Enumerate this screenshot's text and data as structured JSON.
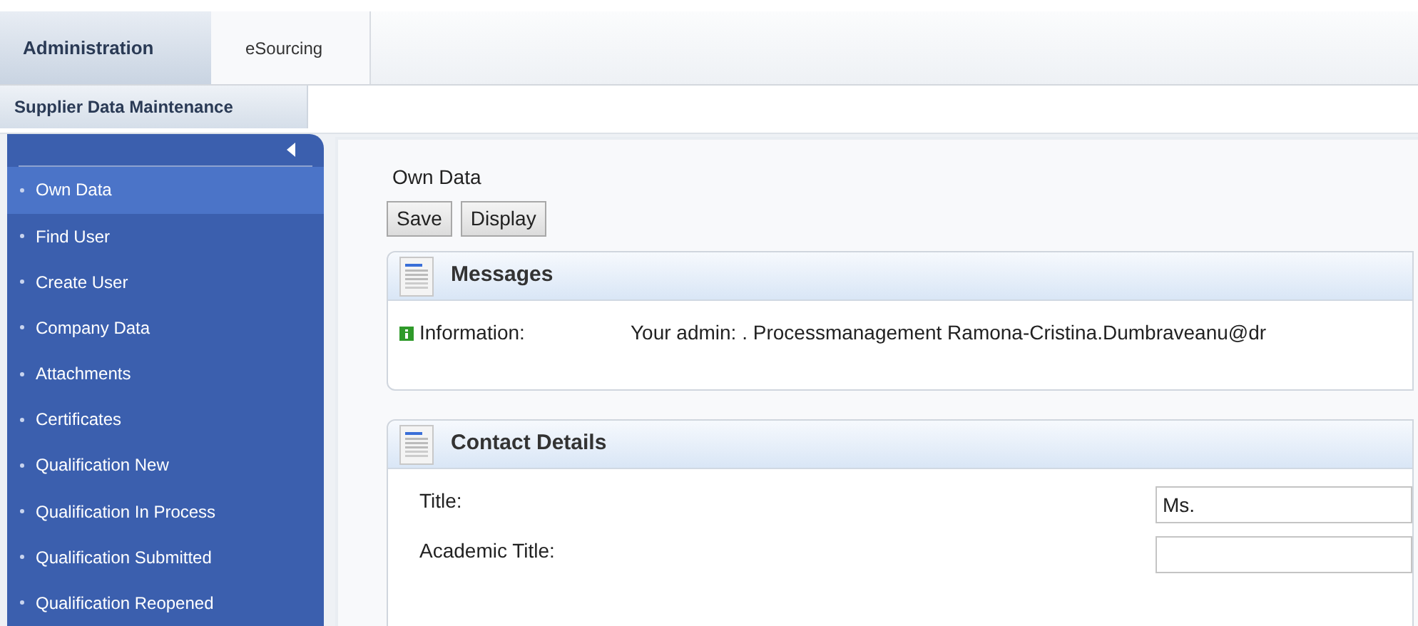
{
  "tabs": [
    {
      "label": "Administration",
      "selected": true
    },
    {
      "label": "eSourcing",
      "selected": false
    }
  ],
  "subnav": {
    "label": "Supplier Data Maintenance"
  },
  "sidebar": {
    "items": [
      {
        "label": "Own Data",
        "selected": true
      },
      {
        "label": "Find User",
        "selected": false
      },
      {
        "label": "Create User",
        "selected": false
      },
      {
        "label": "Company Data",
        "selected": false
      },
      {
        "label": "Attachments",
        "selected": false
      },
      {
        "label": "Certificates",
        "selected": false
      },
      {
        "label": "Qualification New",
        "selected": false
      },
      {
        "label": "Qualification In Process",
        "selected": false
      },
      {
        "label": "Qualification Submitted",
        "selected": false
      },
      {
        "label": "Qualification Reopened",
        "selected": false
      }
    ]
  },
  "page_title": "Own Data",
  "buttons": [
    "Save",
    "Display"
  ],
  "messages": {
    "title": "Messages",
    "items": [
      {
        "type": "Information:",
        "text": "Your admin: . Processmanagement Ramona-Cristina.Dumbraveanu@dr"
      }
    ]
  },
  "contact_details": {
    "title": "Contact Details",
    "fields": [
      {
        "label": "Title:",
        "value": "Ms."
      },
      {
        "label": "Academic Title:"
      }
    ]
  }
}
